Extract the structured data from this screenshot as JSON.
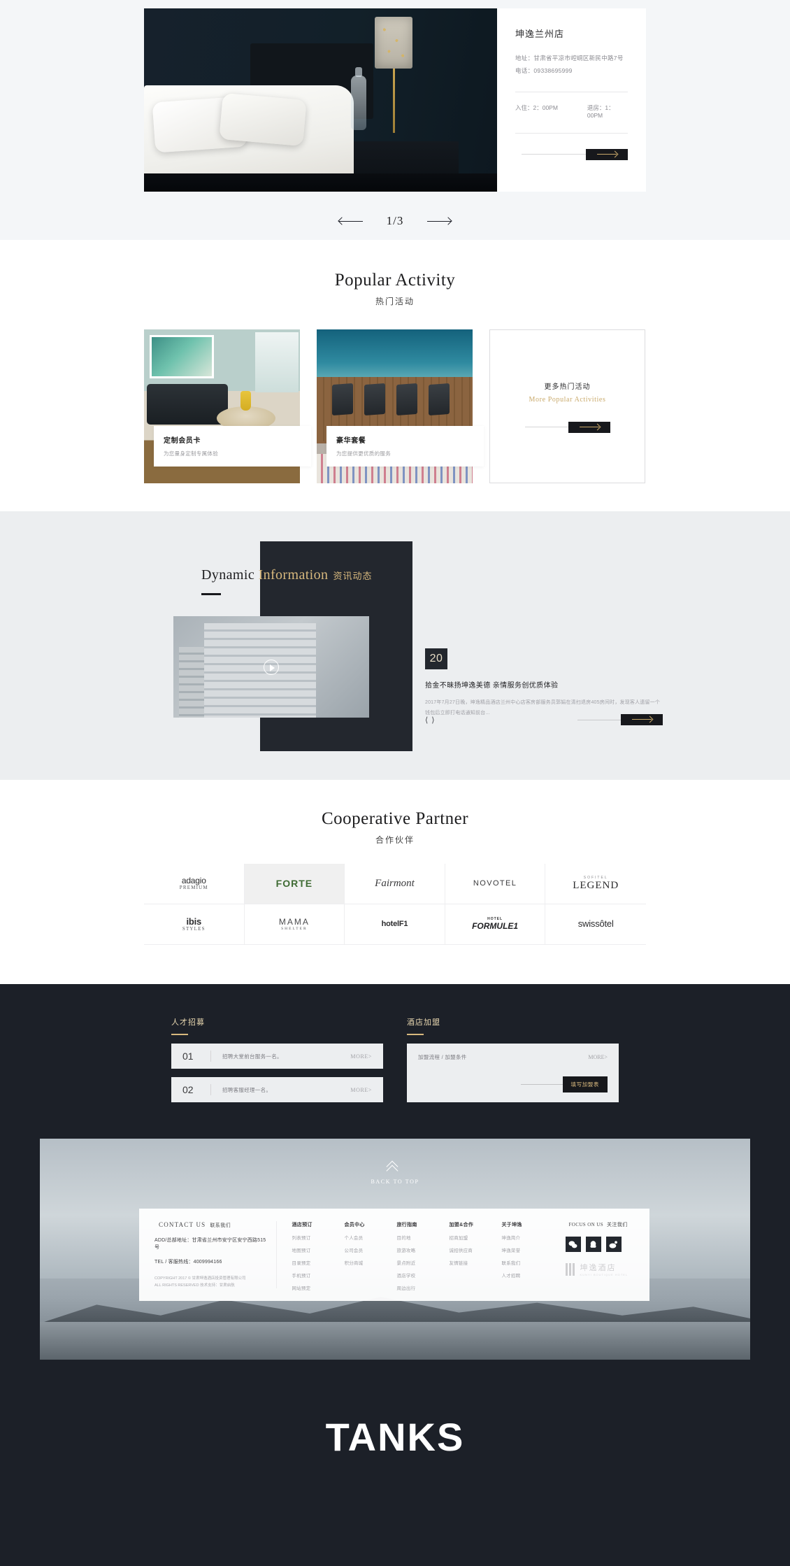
{
  "hero": {
    "hotel_name": "坤逸兰州店",
    "address": "地址：甘肃省平凉市崆峒区新民中路7号",
    "phone": "电话：09338695999",
    "checkin": "入住：2：00PM",
    "checkout": "退房：1：00PM",
    "counter": "1/3",
    "prev_icon": "arrow-left-icon",
    "next_icon": "arrow-right-icon"
  },
  "popular": {
    "title_en": "Popular Activity",
    "title_cn": "热门活动",
    "cards": [
      {
        "title": "定制会员卡",
        "subtitle": "为您量身定制专属体验"
      },
      {
        "title": "豪华套餐",
        "subtitle": "为您提供更优质的服务"
      }
    ],
    "more_cn": "更多热门活动",
    "more_en": "More Popular Activities"
  },
  "dynamic": {
    "title_word1": "Dynamic ",
    "title_word2": "Information",
    "title_cn": "资讯动态",
    "news_day": "20",
    "news_title": "拾金不昧扬坤逸美德 亲情服务创优质体验",
    "news_desc": "2017年7月27日晚，坤逸精品酒店兰州中心店客房部服务员郭娟在清扫退房405房间时，发现客人遗留一个钱包后立即打电话通知前台...",
    "prev_icon": "chevron-left-icon",
    "next_icon": "chevron-right-icon"
  },
  "partner": {
    "title_en": "Cooperative Partner",
    "title_cn": "合作伙伴",
    "logos": [
      {
        "name": "adagio-premium",
        "top": "adagio",
        "bottom": "PREMIUM",
        "style": "plain"
      },
      {
        "name": "forte",
        "top": "FORTE",
        "bottom": "",
        "style": "forte",
        "highlight": true
      },
      {
        "name": "fairmont",
        "top": "Fairmont",
        "bottom": "",
        "style": "fairmont"
      },
      {
        "name": "novotel",
        "top": "NOVOTEL",
        "bottom": "",
        "style": "novotel"
      },
      {
        "name": "sofitel-legend",
        "top": "SOFITEL",
        "bottom": "LEGEND",
        "style": "legend"
      },
      {
        "name": "ibis-styles",
        "top": "ibis",
        "bottom": "STYLES",
        "style": "ibis"
      },
      {
        "name": "mama-shelter",
        "top": "MAMA",
        "bottom": "SHELTER",
        "style": "mama"
      },
      {
        "name": "hotel-f1",
        "top": "hotelF1",
        "bottom": "",
        "style": "plain"
      },
      {
        "name": "hotel-formule-1",
        "top": "HOTEL",
        "bottom": "FORMULE1",
        "style": "f1"
      },
      {
        "name": "swissotel",
        "top": "swissôtel",
        "bottom": "",
        "style": "swiss"
      }
    ]
  },
  "recruit": {
    "heading": "人才招募",
    "items": [
      {
        "no": "01",
        "text": "招聘大堂前台服务一名。",
        "more": "MORE>"
      },
      {
        "no": "02",
        "text": "招聘客服经理一名。",
        "more": "MORE>"
      }
    ]
  },
  "franchise": {
    "heading": "酒店加盟",
    "text": "加盟流程 / 加盟条件",
    "more": "MORE>",
    "button": "填写加盟表"
  },
  "back_to_top": {
    "label": "BACK TO TOP",
    "icon": "chevron-up-icon"
  },
  "footer": {
    "contact_en": "CONTACT US",
    "contact_cn": "联系我们",
    "address": "ADD/总部地址：甘肃省兰州市安宁区安宁西路515号",
    "tel": "TEL / 客服热线：4009994166",
    "copyright1": "COPYRIGHT 2017 © 甘肃坤逸酒店投资管理有限公司",
    "copyright2": "ALL RIGHTS RESERVED 技术支持：甘肃启航",
    "columns": [
      {
        "head": "酒店预订",
        "items": [
          "列表预订",
          "地图预订",
          "目录预定",
          "手机预订",
          "网站预定"
        ]
      },
      {
        "head": "会员中心",
        "items": [
          "个人会员",
          "公司会员",
          "积分商城"
        ]
      },
      {
        "head": "旅行指南",
        "items": [
          "目的地",
          "旅游攻略",
          "景点附近",
          "酒店学校",
          "周边出行"
        ]
      },
      {
        "head": "加盟&合作",
        "items": [
          "招商加盟",
          "诚招供应商",
          "友情链接"
        ]
      },
      {
        "head": "关于坤逸",
        "items": [
          "坤逸简介",
          "坤逸荣誉",
          "联系我们",
          "人才招聘"
        ]
      }
    ],
    "focus_en": "FOCUS ON US",
    "focus_cn": "关注我们",
    "socials": [
      {
        "name": "wechat-icon",
        "glyph": "✆"
      },
      {
        "name": "qq-icon",
        "glyph": "🐧"
      },
      {
        "name": "weibo-icon",
        "glyph": "◉"
      }
    ],
    "brand_cn": "坤逸酒店",
    "brand_en": "KUNYI BOUTIQUE HOTEL"
  },
  "tanks": {
    "text": "TANKS"
  }
}
